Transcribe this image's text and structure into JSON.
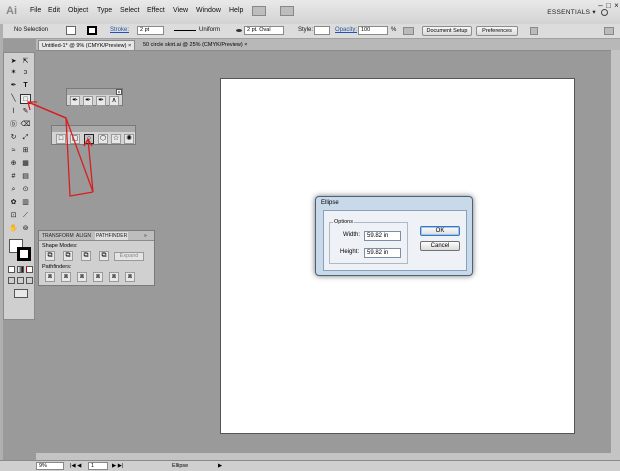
{
  "app": {
    "logo": "Ai"
  },
  "menu": [
    "File",
    "Edit",
    "Object",
    "Type",
    "Select",
    "Effect",
    "View",
    "Window",
    "Help"
  ],
  "workspace": {
    "label": "ESSENTIALS ▾"
  },
  "control": {
    "selection": "No Selection",
    "stroke_label": "Stroke:",
    "stroke_value": "2 pt",
    "profile": "Uniform",
    "brush": "2 pt. Oval",
    "style_label": "Style:",
    "opacity_label": "Opacity:",
    "opacity_value": "100",
    "opacity_unit": "%",
    "doc_setup": "Document Setup",
    "preferences": "Preferences"
  },
  "tabs": [
    {
      "label": "Untitled-1* @ 9% (CMYK/Preview)",
      "close": "×"
    },
    {
      "label": "50 circle skirt.ai @ 25% (CMYK/Preview)",
      "close": "×"
    }
  ],
  "panel": {
    "tabs": [
      "TRANSFORM",
      "ALIGN",
      "PATHFINDER"
    ],
    "collapse": "»",
    "shape_modes": "Shape Modes:",
    "expand": "Expand",
    "pathfinders": "Pathfinders:"
  },
  "dialog": {
    "title": "Ellipse",
    "group": "Options",
    "width_label": "Width:",
    "width_value": "59.82 in",
    "height_label": "Height:",
    "height_value": "59.82 in",
    "ok": "OK",
    "cancel": "Cancel"
  },
  "status": {
    "zoom": "9%",
    "page": "1",
    "tool": "Ellipse"
  },
  "colors": {
    "annotation": "#d81e1e",
    "dialog_frame": "#c8d9ea",
    "accent": "#3a77c2"
  }
}
